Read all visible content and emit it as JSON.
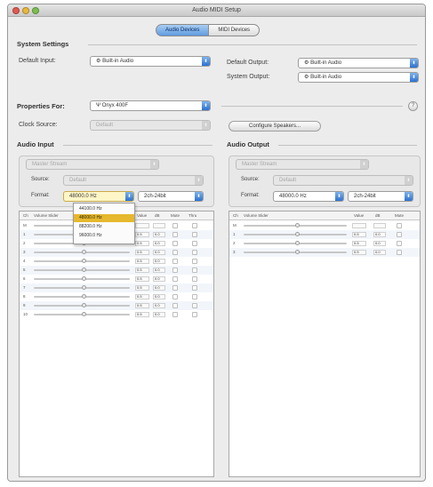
{
  "window": {
    "title": "Audio MIDI Setup"
  },
  "tabs": [
    {
      "label": "Audio Devices",
      "active": true
    },
    {
      "label": "MIDI Devices",
      "active": false
    }
  ],
  "system_settings": {
    "heading": "System Settings",
    "default_input_label": "Default Input:",
    "default_input_value": "Built-in Audio",
    "default_output_label": "Default Output:",
    "default_output_value": "Built-in Audio",
    "system_output_label": "System Output:",
    "system_output_value": "Built-in Audio"
  },
  "properties": {
    "label": "Properties For:",
    "value": "Onyx 400F",
    "clock_source_label": "Clock Source:",
    "clock_source_value": "Default",
    "configure_speakers": "Configure Speakers...",
    "help": "?"
  },
  "audio_input": {
    "heading": "Audio Input",
    "master_stream": "Master Stream",
    "source_label": "Source:",
    "source_value": "Default",
    "format_label": "Format:",
    "format_rate": "48000.0 Hz",
    "format_bits": "2ch-24bit",
    "columns": [
      "Ch",
      "Volume Slider",
      "Value",
      "dB",
      "Mute",
      "Thru"
    ],
    "rows": [
      {
        "ch": "M",
        "value": "",
        "db": ""
      },
      {
        "ch": "1",
        "value": "0.5",
        "db": "0.0"
      },
      {
        "ch": "2",
        "value": "0.5",
        "db": "0.0"
      },
      {
        "ch": "3",
        "value": "0.5",
        "db": "0.0"
      },
      {
        "ch": "4",
        "value": "0.5",
        "db": "0.0"
      },
      {
        "ch": "5",
        "value": "0.5",
        "db": "0.0"
      },
      {
        "ch": "6",
        "value": "0.5",
        "db": "0.0"
      },
      {
        "ch": "7",
        "value": "0.5",
        "db": "0.0"
      },
      {
        "ch": "8",
        "value": "0.5",
        "db": "0.0"
      },
      {
        "ch": "9",
        "value": "0.5",
        "db": "0.0"
      },
      {
        "ch": "10",
        "value": "0.5",
        "db": "0.0"
      }
    ],
    "rate_menu": {
      "options": [
        "44100.0 Hz",
        "48000.0 Hz",
        "88200.0 Hz",
        "96000.0 Hz"
      ],
      "selected_index": 1
    }
  },
  "audio_output": {
    "heading": "Audio Output",
    "master_stream": "Master Stream",
    "source_label": "Source:",
    "source_value": "Default",
    "format_label": "Format:",
    "format_rate": "48000.0 Hz",
    "format_bits": "2ch-24bit",
    "columns": [
      "Ch",
      "Volume Slider",
      "Value",
      "dB",
      "Mute"
    ],
    "rows": [
      {
        "ch": "M",
        "value": "",
        "db": ""
      },
      {
        "ch": "1",
        "value": "0.5",
        "db": "0.0"
      },
      {
        "ch": "2",
        "value": "0.5",
        "db": "0.0"
      },
      {
        "ch": "3",
        "value": "0.5",
        "db": "0.0"
      }
    ]
  },
  "icons": {
    "popup_arrow": "⬍",
    "device_icon": "⚙",
    "firewire_icon": "Ψ"
  }
}
